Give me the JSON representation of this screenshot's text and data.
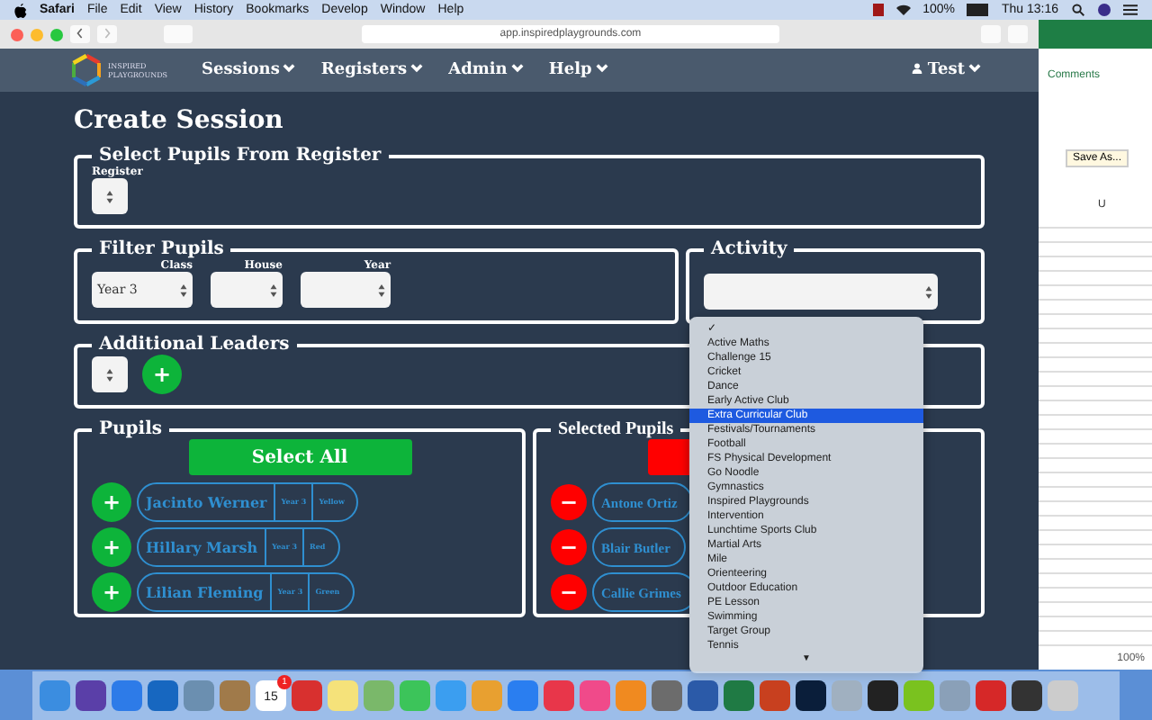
{
  "menu_bar": {
    "app": "Safari",
    "items": [
      "File",
      "Edit",
      "View",
      "History",
      "Bookmarks",
      "Develop",
      "Window",
      "Help"
    ],
    "battery": "100%",
    "clock": "Thu 13:16"
  },
  "browser": {
    "url": "app.inspiredplaygrounds.com"
  },
  "nav": {
    "logo": [
      "INSPIRED",
      "PLAYGROUNDS"
    ],
    "items": [
      "Sessions",
      "Registers",
      "Admin",
      "Help"
    ],
    "user": "Test"
  },
  "page_title": "Create Session",
  "register_section": {
    "legend": "Select Pupils From Register",
    "label": "Register"
  },
  "filter_section": {
    "legend": "Filter Pupils",
    "fields": [
      {
        "label": "Class",
        "value": "Year 3"
      },
      {
        "label": "House"
      },
      {
        "label": "Year"
      }
    ]
  },
  "activity_section": {
    "legend": "Activity",
    "dropdown": {
      "checkmark": "✓",
      "more": "▼",
      "options": [
        {
          "label": "Active Maths",
          "selected": false
        },
        {
          "label": "Challenge 15",
          "selected": false
        },
        {
          "label": "Cricket",
          "selected": false
        },
        {
          "label": "Dance",
          "selected": false
        },
        {
          "label": "Early Active Club",
          "selected": false
        },
        {
          "label": "Extra Curricular Club",
          "selected": true
        },
        {
          "label": "Festivals/Tournaments",
          "selected": false
        },
        {
          "label": "Football",
          "selected": false
        },
        {
          "label": "FS Physical Development",
          "selected": false
        },
        {
          "label": "Go Noodle",
          "selected": false
        },
        {
          "label": "Gymnastics",
          "selected": false
        },
        {
          "label": "Inspired Playgrounds",
          "selected": false
        },
        {
          "label": "Intervention",
          "selected": false
        },
        {
          "label": "Lunchtime Sports Club",
          "selected": false
        },
        {
          "label": "Martial Arts",
          "selected": false
        },
        {
          "label": "Mile",
          "selected": false
        },
        {
          "label": "Orienteering",
          "selected": false
        },
        {
          "label": "Outdoor Education",
          "selected": false
        },
        {
          "label": "PE Lesson",
          "selected": false
        },
        {
          "label": "Swimming",
          "selected": false
        },
        {
          "label": "Target Group",
          "selected": false
        },
        {
          "label": "Tennis",
          "selected": false
        }
      ]
    }
  },
  "leaders_section": {
    "legend": "Additional Leaders",
    "add_button": "+"
  },
  "pupils": {
    "legend": "Pupils",
    "select_all": "Select All",
    "rows": [
      {
        "button": "+",
        "name": "Jacinto Werner",
        "year": "Year 3",
        "house": "Yellow"
      },
      {
        "button": "+",
        "name": "Hillary Marsh",
        "year": "Year 3",
        "house": "Red"
      },
      {
        "button": "+",
        "name": "Lilian Fleming",
        "year": "Year 3",
        "house": "Green"
      }
    ]
  },
  "selected_pupils": {
    "legend": "Selected Pupils",
    "rows": [
      {
        "button": "−",
        "name": "Antone Ortiz"
      },
      {
        "button": "−",
        "name": "Blair Butler"
      },
      {
        "button": "−",
        "name": "Callie Grimes"
      }
    ]
  },
  "spreadsheet": {
    "tab": "Comments",
    "button": "Save As...",
    "column": "U",
    "zoom": "100%"
  },
  "dock": {
    "calendar_day": "15",
    "calendar_badge": "1"
  }
}
